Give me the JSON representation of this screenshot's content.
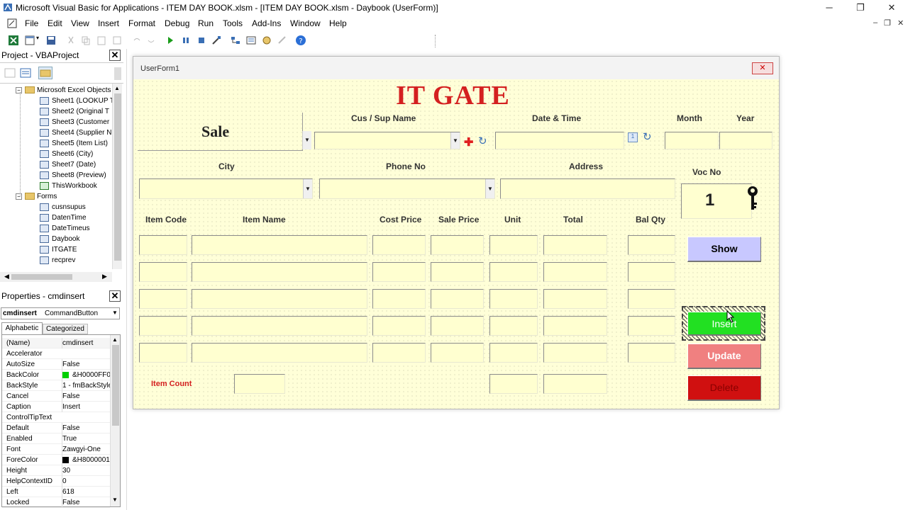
{
  "window": {
    "title": "Microsoft Visual Basic for Applications - ITEM DAY BOOK.xlsm - [ITEM DAY BOOK.xlsm - Daybook (UserForm)]",
    "min": "─",
    "restore": "❐",
    "close": "✕"
  },
  "menu": [
    {
      "label": "File"
    },
    {
      "label": "Edit"
    },
    {
      "label": "View"
    },
    {
      "label": "Insert"
    },
    {
      "label": "Format"
    },
    {
      "label": "Debug"
    },
    {
      "label": "Run"
    },
    {
      "label": "Tools"
    },
    {
      "label": "Add-Ins"
    },
    {
      "label": "Window"
    },
    {
      "label": "Help"
    }
  ],
  "mdi": {
    "min": "–",
    "restore": "❐",
    "close": "✕"
  },
  "project": {
    "title": "Project - VBAProject",
    "close": "✕",
    "folder_objects": "Microsoft Excel Objects",
    "sheets": [
      "Sheet1 (LOOKUP T",
      "Sheet2 (Original T",
      "Sheet3 (Customer",
      "Sheet4 (Supplier N",
      "Sheet5 (Item List)",
      "Sheet6 (City)",
      "Sheet7 (Date)",
      "Sheet8 (Preview)",
      "ThisWorkbook"
    ],
    "folder_forms": "Forms",
    "forms": [
      "cusnsupus",
      "DatenTime",
      "DateTimeus",
      "Daybook",
      "ITGATE",
      "recprev"
    ]
  },
  "properties": {
    "title": "Properties - cmdinsert",
    "close": "✕",
    "object_name": "cmdinsert",
    "object_type": "CommandButton",
    "tab_alphabetic": "Alphabetic",
    "tab_categorized": "Categorized",
    "rows": [
      {
        "name": "(Name)",
        "value": "cmdinsert"
      },
      {
        "name": "Accelerator",
        "value": ""
      },
      {
        "name": "AutoSize",
        "value": "False"
      },
      {
        "name": "BackColor",
        "value": "&H0000FF0"
      },
      {
        "name": "BackStyle",
        "value": "1 - fmBackStyle"
      },
      {
        "name": "Cancel",
        "value": "False"
      },
      {
        "name": "Caption",
        "value": "Insert"
      },
      {
        "name": "ControlTipText",
        "value": ""
      },
      {
        "name": "Default",
        "value": "False"
      },
      {
        "name": "Enabled",
        "value": "True"
      },
      {
        "name": "Font",
        "value": "Zawgyi-One"
      },
      {
        "name": "ForeColor",
        "value": "&H8000001"
      },
      {
        "name": "Height",
        "value": "30"
      },
      {
        "name": "HelpContextID",
        "value": "0"
      },
      {
        "name": "Left",
        "value": "618"
      },
      {
        "name": "Locked",
        "value": "False"
      }
    ],
    "backcolor_swatch": "#00d000",
    "forecolor_swatch": "#000000"
  },
  "form": {
    "caption": "UserForm1",
    "close": "✕",
    "heading": "IT GATE",
    "heading_color": "#d42020",
    "sale_label": "Sale",
    "cus_sup_label": "Cus / Sup Name",
    "date_time_label": "Date & Time",
    "month_label": "Month",
    "year_label": "Year",
    "city_label": "City",
    "phone_label": "Phone No",
    "address_label": "Address",
    "voc_label": "Voc No",
    "voc_value": "1",
    "columns": [
      "Item Code",
      "Item Name",
      "Cost Price",
      "Sale Price",
      "Unit",
      "Total",
      "Bal Qty"
    ],
    "item_count_label": "Item Count",
    "buttons": {
      "show": "Show",
      "insert": "Insert",
      "update": "Update",
      "delete": "Delete"
    },
    "colors": {
      "show": "#c8c8ff",
      "insert": "#22e022",
      "update": "#f08080",
      "delete": "#d01010",
      "item_count": "#d42020"
    }
  }
}
